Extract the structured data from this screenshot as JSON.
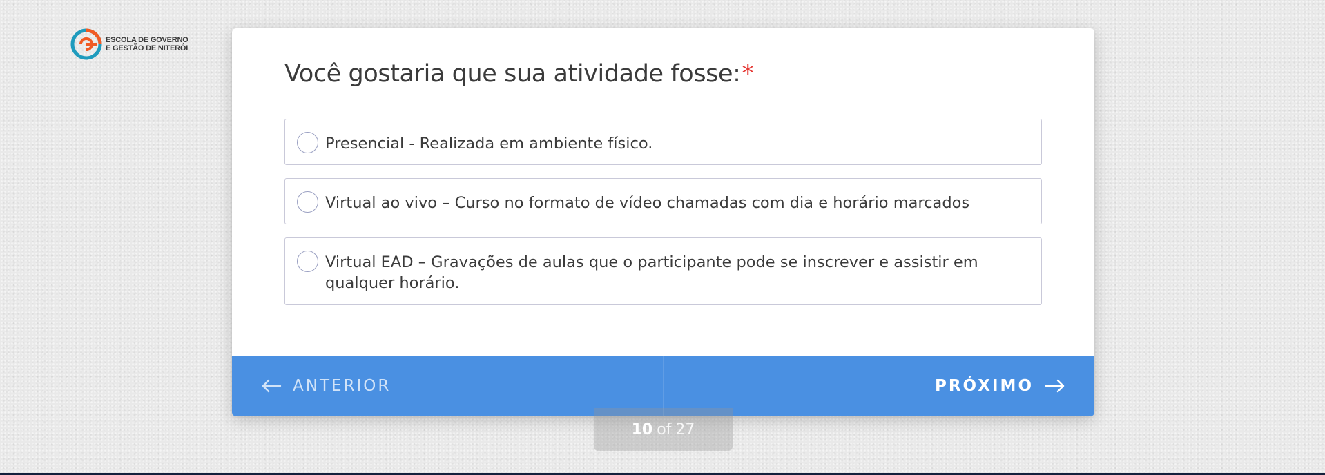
{
  "logo": {
    "line1": "ESCOLA DE GOVERNO",
    "line2": "E GESTÃO DE NITERÓI",
    "colors": {
      "orange": "#f15a24",
      "teal": "#1f9bbd"
    }
  },
  "question": {
    "title": "Você gostaria que sua atividade fosse:",
    "required_mark": "*",
    "options": [
      {
        "label": "Presencial - Realizada em ambiente físico.",
        "selected": false
      },
      {
        "label": "Virtual ao vivo – Curso no formato de vídeo chamadas com dia e horário marcados",
        "selected": false
      },
      {
        "label": "Virtual EAD – Gravações de aulas que o participante pode se inscrever e assistir em qualquer horário.",
        "selected": false
      }
    ]
  },
  "navigation": {
    "prev_label": "ANTERIOR",
    "next_label": "PRÓXIMO",
    "prev_icon": "arrow-left-icon",
    "next_icon": "arrow-right-icon",
    "bar_color": "#4a90e2"
  },
  "progress": {
    "current": "10",
    "separator": "of",
    "total": "27"
  }
}
